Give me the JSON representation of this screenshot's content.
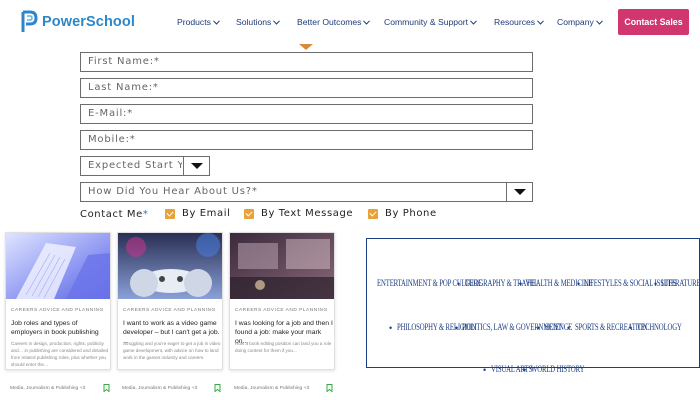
{
  "brand": {
    "name": "PowerSchool",
    "color": "#2e86c9"
  },
  "nav": {
    "items": [
      {
        "label": "Products"
      },
      {
        "label": "Solutions"
      },
      {
        "label": "Better Outcomes"
      },
      {
        "label": "Community & Support"
      },
      {
        "label": "Resources"
      },
      {
        "label": "Company"
      }
    ],
    "cta_label": "Contact Sales",
    "cta_color": "#d2366f"
  },
  "form": {
    "first_name": {
      "placeholder": "First Name:*"
    },
    "last_name": {
      "placeholder": "Last Name:*"
    },
    "email": {
      "placeholder": "E-Mail:*"
    },
    "mobile": {
      "placeholder": "Mobile:*"
    },
    "start_year": {
      "value": "Expected Start Y"
    },
    "heard_about": {
      "value": "How Did You Hear About Us?*"
    },
    "contact_me": {
      "label": "Contact Me",
      "required_mark": "*"
    },
    "contact_options": [
      {
        "label": "By Email",
        "checked": true
      },
      {
        "label": "By Text Message",
        "checked": true
      },
      {
        "label": "By Phone",
        "checked": true
      }
    ],
    "checkbox_color": "#e7a23a"
  },
  "cards": [
    {
      "category": "CAREERS ADVICE AND PLANNING",
      "title": "Job roles and types of employers in book publishing",
      "description": "Careers in design, production, rights, publicity and… in publishing are considered and detailed from related publishing roles, plus whether you should enter the…",
      "footer": "Media, Journalism & Publishing +3",
      "image": "books-photo"
    },
    {
      "category": "CAREERS ADVICE AND PLANNING",
      "title": "I want to work as a video game developer – but I can't get a job. ...",
      "description": "Struggling and you're eager to get a job in video game development, with advice on how to land work in the games industry and careers.",
      "footer": "Media, Journalism & Publishing +3",
      "image": "game-controller-photo"
    },
    {
      "category": "CAREERS ADVICE AND PLANNING",
      "title": "I was looking for a job and then I found a job: make your mark on...",
      "description": "How a book editing position can land you a role doing content for them if you...",
      "footer": "Media, Journalism & Publishing +3",
      "image": "studio-photo"
    }
  ],
  "topics": {
    "border_color": "#1b3e86",
    "items": [
      "ENTERTAINMENT & POP CULTURE",
      "GEOGRAPHY & TRAVEL",
      "HEALTH & MEDICINE",
      "LIFESTYLES & SOCIAL ISSUES",
      "LITERATURE",
      "PHILOSOPHY & RELIGION",
      "POLITICS, LAW & GOVERNMENT",
      "SCIENCE",
      "SPORTS & RECREATION",
      "TECHNOLOGY",
      "VISUAL ARTS",
      "WORLD HISTORY"
    ]
  }
}
